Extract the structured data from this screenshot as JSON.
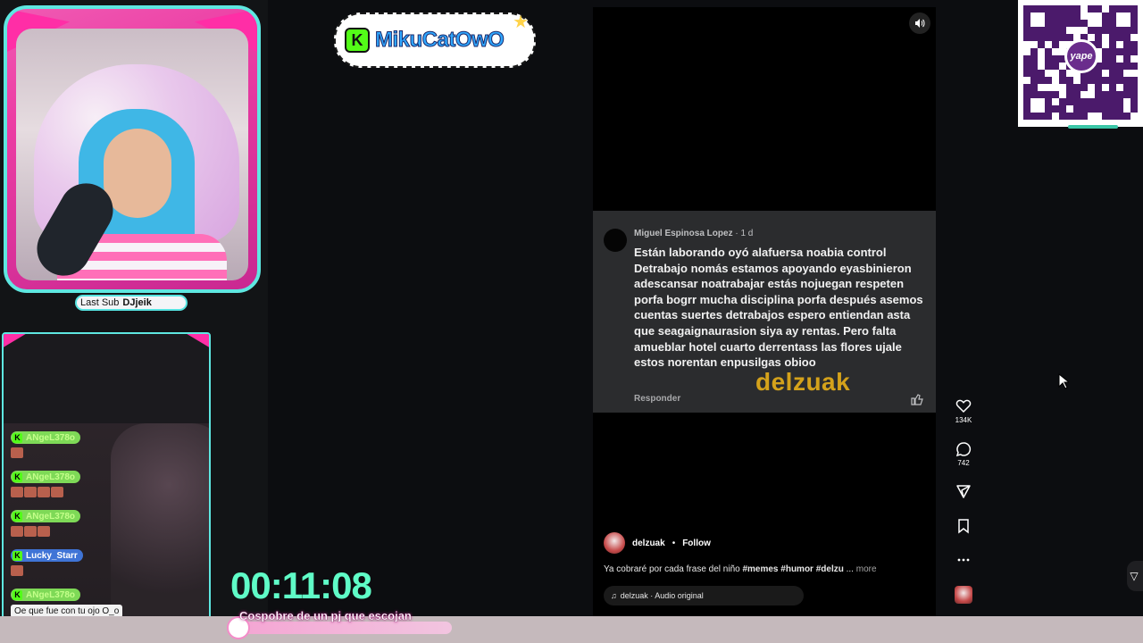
{
  "overlay": {
    "last_sub_label": "Last Sub",
    "last_sub_name": "DJjeik",
    "timer": "00:11:08",
    "goal_text": "Cospobre de un pj que escojan",
    "logo_text": "MikuCatOwO",
    "logo_badge": "K"
  },
  "chat": {
    "messages": [
      {
        "user": "ANgeL378o",
        "type": "emotes",
        "emote_count": 1
      },
      {
        "user": "ANgeL378o",
        "type": "emotes",
        "emote_count": 4
      },
      {
        "user": "ANgeL378o",
        "type": "emotes",
        "emote_count": 3
      },
      {
        "user": "Lucky_Starr",
        "type": "emotes",
        "emote_count": 1
      },
      {
        "user": "ANgeL378o",
        "type": "text",
        "text": "Oe que fue con tu ojo O_o"
      }
    ]
  },
  "video": {
    "mute_icon": "speaker-icon",
    "comment": {
      "author": "Miguel Espinosa Lopez",
      "age": "· 1 d",
      "text": "Están laborando oyó alafuersa noabia control Detrabajo nomás estamos apoyando eyasbinieron adescansar noatrabajar estás nojuegan respeten porfa bogrr mucha disciplina porfa después asemos cuentas suertes detrabajos espero entiendan asta que seagaignaurasion siya ay rentas. Pero falta amueblar hotel cuarto derrentass las flores ujale estos norentan enpusilgas obioo",
      "reply_label": "Responder",
      "watermark": "delzuak"
    },
    "author": {
      "name": "delzuak",
      "separator": "•",
      "follow_label": "Follow"
    },
    "caption": {
      "text": "Ya cobraré por cada frase del niño ",
      "tags": "#memes #humor #delzu",
      "ellipsis": "...",
      "more_label": "more"
    },
    "audio": {
      "icon": "music-note-icon",
      "label": "delzuak · Audio original"
    }
  },
  "rail": {
    "likes": "134K",
    "comments": "742"
  },
  "qr": {
    "logo_text": "yape"
  },
  "colors": {
    "accent_pink": "#ff2ea6",
    "accent_cyan": "#5ee7e1",
    "timer_green": "#5ffcc7",
    "kick_green": "#53fc18"
  }
}
